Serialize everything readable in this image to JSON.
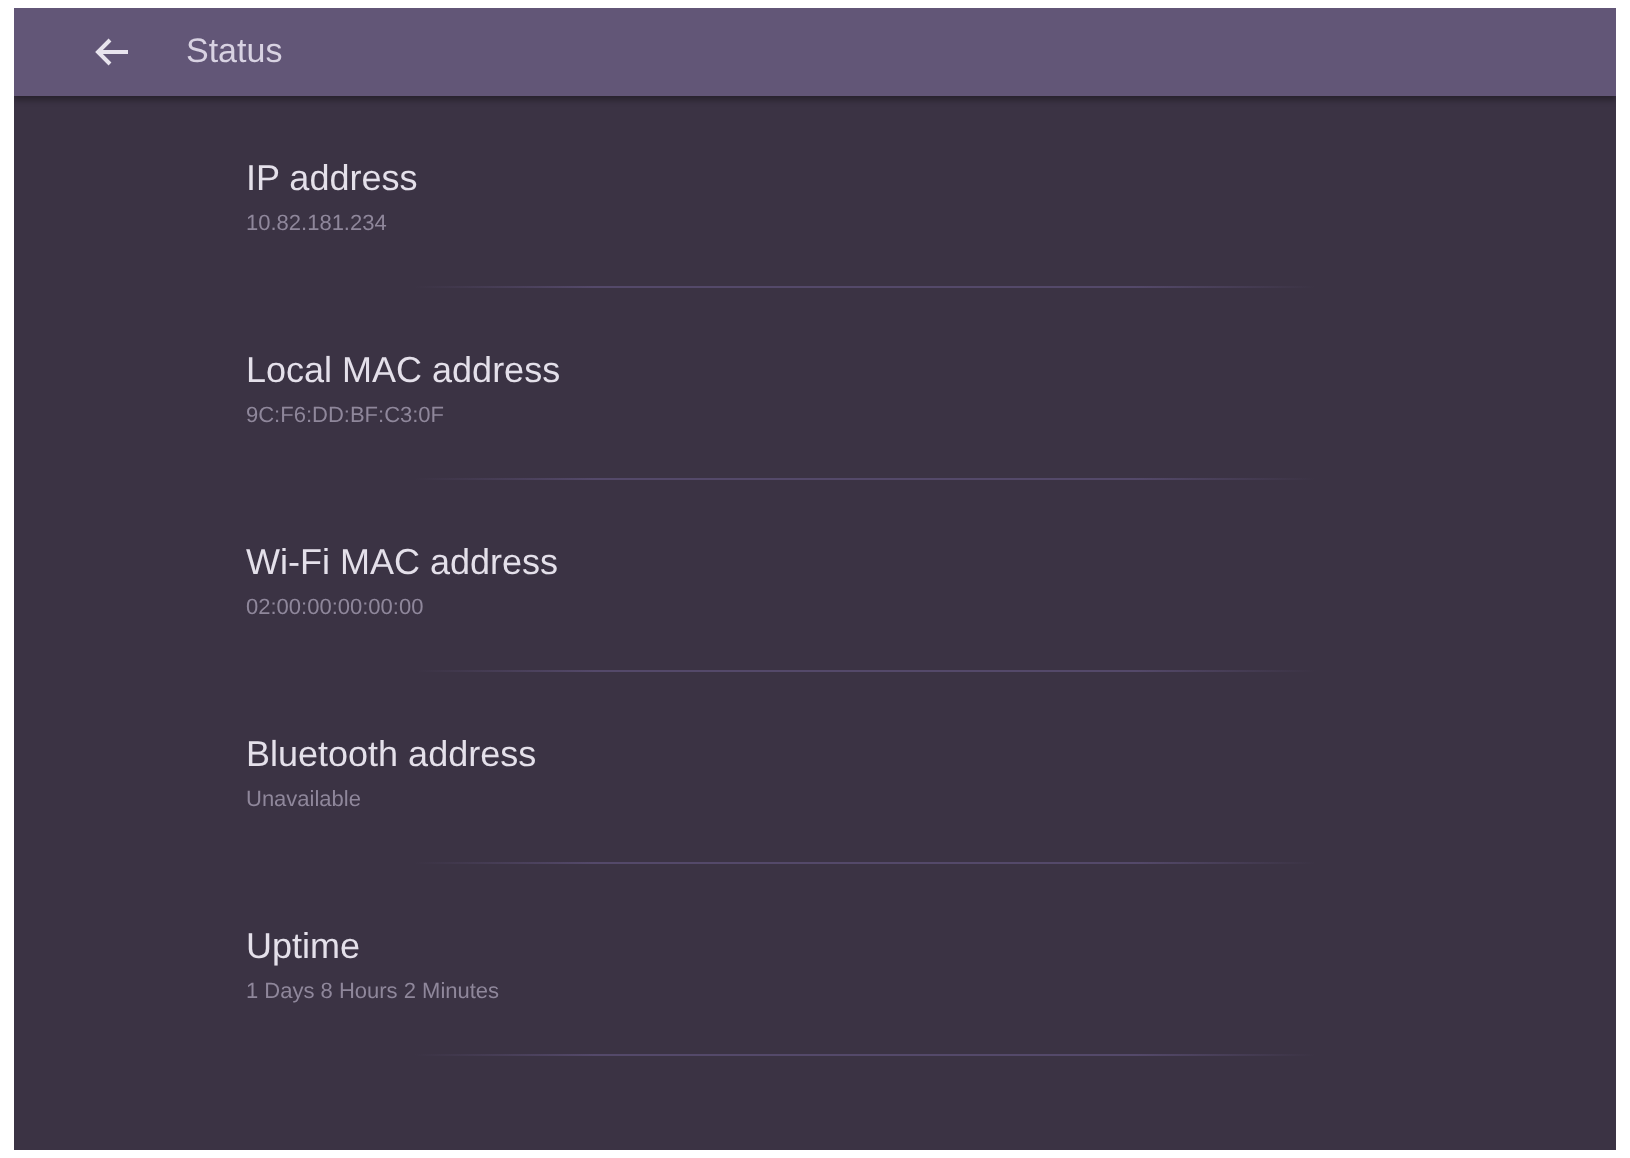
{
  "header": {
    "title": "Status"
  },
  "items": [
    {
      "label": "IP address",
      "value": "10.82.181.234"
    },
    {
      "label": "Local MAC address",
      "value": "9C:F6:DD:BF:C3:0F"
    },
    {
      "label": "Wi-Fi MAC address",
      "value": "02:00:00:00:00:00"
    },
    {
      "label": "Bluetooth address",
      "value": "Unavailable"
    },
    {
      "label": "Uptime",
      "value": "1 Days 8 Hours 2 Minutes"
    }
  ]
}
